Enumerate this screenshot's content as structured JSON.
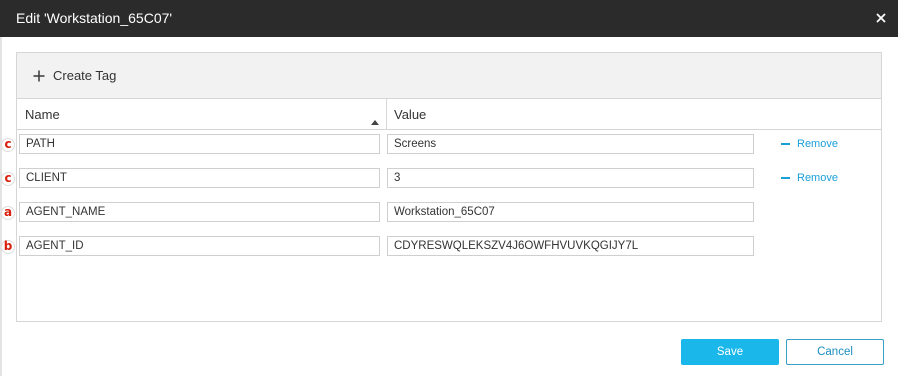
{
  "dialog": {
    "title": "Edit 'Workstation_65C07'",
    "close_icon": "close-icon"
  },
  "toolbar": {
    "create_tag_label": "Create Tag",
    "create_tag_icon": "plus-icon"
  },
  "table": {
    "columns": {
      "name": "Name",
      "value": "Value"
    },
    "sort": "name-ascending",
    "rows": [
      {
        "badge": "c",
        "name": "PATH",
        "value": "Screens",
        "action": "Remove"
      },
      {
        "badge": "c",
        "name": "CLIENT",
        "value": "3",
        "action": "Remove"
      },
      {
        "badge": "a",
        "name": "AGENT_NAME",
        "value": "Workstation_65C07",
        "action": ""
      },
      {
        "badge": "b",
        "name": "AGENT_ID",
        "value": "CDYRESWQLEKSZV4J6OWFHVUVKQGIJY7L",
        "action": ""
      }
    ]
  },
  "footer": {
    "save_label": "Save",
    "cancel_label": "Cancel"
  },
  "colors": {
    "titlebar": "#2b2b2b",
    "accent": "#1ab7ea",
    "link": "#1a9fd9",
    "badge_text": "#d9200f"
  }
}
